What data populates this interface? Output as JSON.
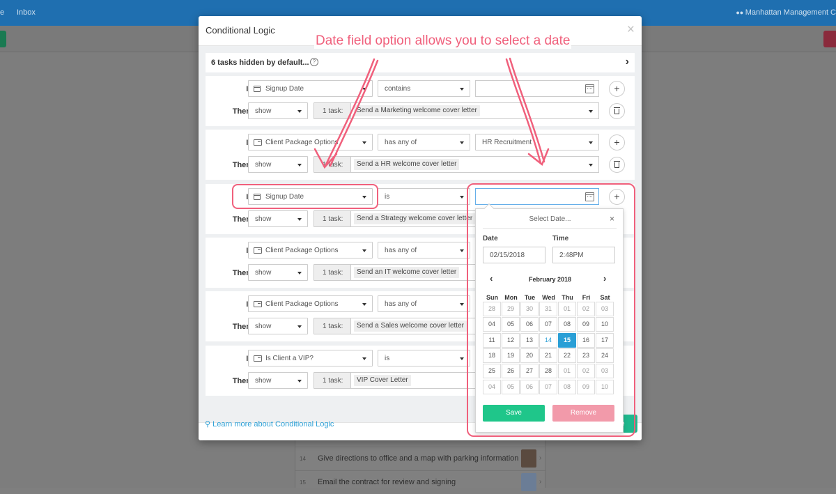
{
  "background": {
    "nav_items": [
      "e",
      "Inbox"
    ],
    "org_name": "Manhattan Management C",
    "list_rows": [
      {
        "num": "14",
        "text": "Give directions to office and a map with parking information"
      },
      {
        "num": "15",
        "text": "Email the contract for review and signing"
      }
    ]
  },
  "modal": {
    "title": "Conditional Logic",
    "close": "×",
    "hidden_label": "6 tasks hidden by default...",
    "hidden_help": "?",
    "learn_link": "Learn more about Conditional Logic",
    "footer_save_peek": "ve"
  },
  "labels": {
    "if": "If",
    "then": "Then",
    "task_count": "1 task:"
  },
  "conditions": [
    {
      "field": "Signup Date",
      "field_icon": "calendar",
      "operator": "contains",
      "value": "",
      "value_type": "date",
      "action": "show",
      "task": "Send a Marketing welcome cover letter"
    },
    {
      "field": "Client Package Options",
      "field_icon": "checkbox-list",
      "operator": "has any of",
      "value": "HR Recruitment",
      "value_type": "select",
      "action": "show",
      "task": "Send a HR welcome cover letter"
    },
    {
      "field": "Signup Date",
      "field_icon": "calendar",
      "operator": "is",
      "value": "",
      "value_type": "date",
      "action": "show",
      "task": "Send a Strategy welcome cover letter"
    },
    {
      "field": "Client Package Options",
      "field_icon": "checkbox-list",
      "operator": "has any of",
      "value": "",
      "value_type": "hidden",
      "action": "show",
      "task": "Send an IT welcome cover letter"
    },
    {
      "field": "Client Package Options",
      "field_icon": "checkbox-list",
      "operator": "has any of",
      "value": "",
      "value_type": "hidden",
      "action": "show",
      "task": "Send a Sales welcome cover letter"
    },
    {
      "field": "Is Client a VIP?",
      "field_icon": "id-card",
      "operator": "is",
      "value": "",
      "value_type": "hidden",
      "action": "show",
      "task": "VIP Cover Letter"
    }
  ],
  "date_picker": {
    "title": "Select Date...",
    "close": "×",
    "date_label": "Date",
    "date_value": "02/15/2018",
    "time_label": "Time",
    "time_value": "2:48PM",
    "prev": "‹",
    "next": "›",
    "month_label": "February 2018",
    "weekdays": [
      "Sun",
      "Mon",
      "Tue",
      "Wed",
      "Thu",
      "Fri",
      "Sat"
    ],
    "weeks": [
      [
        "28",
        "29",
        "30",
        "31",
        "01",
        "02",
        "03"
      ],
      [
        "04",
        "05",
        "06",
        "07",
        "08",
        "09",
        "10"
      ],
      [
        "11",
        "12",
        "13",
        "14",
        "15",
        "16",
        "17"
      ],
      [
        "18",
        "19",
        "20",
        "21",
        "22",
        "23",
        "24"
      ],
      [
        "25",
        "26",
        "27",
        "28",
        "01",
        "02",
        "03"
      ],
      [
        "04",
        "05",
        "06",
        "07",
        "08",
        "09",
        "10"
      ]
    ],
    "today": "14",
    "selected": "15",
    "save_label": "Save",
    "remove_label": "Remove"
  },
  "annotation": {
    "text": "Date field option allows you to select a date",
    "color": "#f0607c"
  },
  "colors": {
    "primary_blue": "#2a9fd6",
    "save_green": "#1fc68a",
    "remove_pink": "#f29aaa",
    "topbar": "#1f6fb0"
  }
}
